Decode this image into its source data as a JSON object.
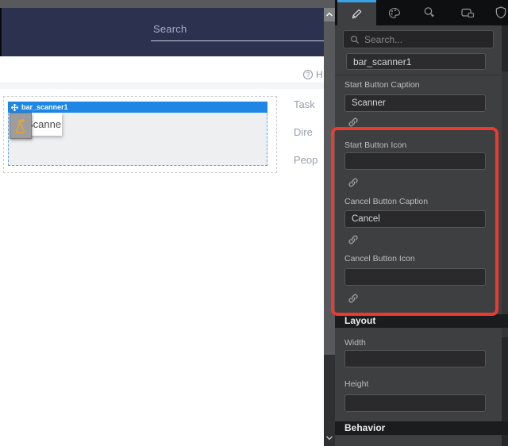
{
  "design_canvas": {
    "top_search_label": "Search",
    "help_link_text": "H",
    "widget": {
      "selection_title": "bar_scanner1",
      "ghost_caption": "Scanner"
    },
    "side_texts": {
      "tasks": "Task",
      "directory": "Dire",
      "people": "Peop"
    }
  },
  "properties_panel": {
    "search_placeholder": "Search...",
    "widget_name_value": "bar_scanner1",
    "fields": {
      "start_caption": {
        "label": "Start Button Caption",
        "value": "Scanner"
      },
      "start_icon": {
        "label": "Start Button Icon",
        "value": ""
      },
      "cancel_caption": {
        "label": "Cancel Button Caption",
        "value": "Cancel"
      },
      "cancel_icon": {
        "label": "Cancel Button Icon",
        "value": ""
      }
    },
    "layout_section": {
      "title": "Layout",
      "width": {
        "label": "Width",
        "value": ""
      },
      "height": {
        "label": "Height",
        "value": ""
      }
    },
    "behavior_section": {
      "title": "Behavior"
    }
  },
  "icons": {
    "tabs": [
      "pencil",
      "palette",
      "magnifier-star",
      "camera",
      "shield"
    ],
    "question_glyph": "?",
    "field_link": "chain-link",
    "panel_search": "magnifier",
    "widget_move": "move-arrows",
    "ghost_icon": "flask"
  },
  "colors": {
    "selection_blue": "#1e87e5",
    "annotation_red": "#e93b2f",
    "tab_indicator_blue": "#3aa3e8",
    "header_navy": "#2c3150",
    "ghost_icon_orange": "#f0a228"
  }
}
